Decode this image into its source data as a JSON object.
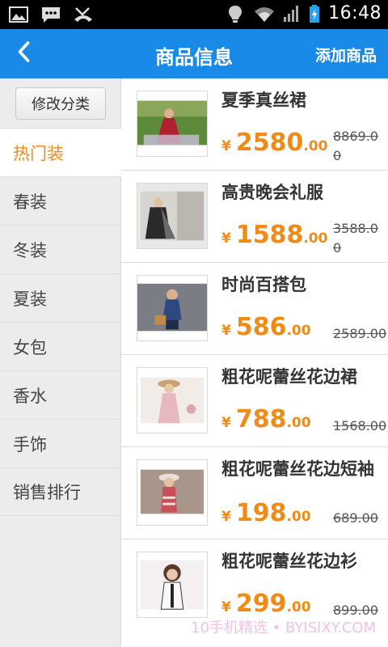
{
  "status_bar": {
    "time": "16:48"
  },
  "header": {
    "title": "商品信息",
    "add_label": "添加商品"
  },
  "sidebar": {
    "edit_label": "修改分类",
    "categories": [
      {
        "label": "热门装",
        "active": true
      },
      {
        "label": "春装"
      },
      {
        "label": "冬装"
      },
      {
        "label": "夏装"
      },
      {
        "label": "女包"
      },
      {
        "label": "香水"
      },
      {
        "label": "手饰"
      },
      {
        "label": "销售排行"
      }
    ]
  },
  "currency_symbol": "¥",
  "products": [
    {
      "name": "夏季真丝裙",
      "price_int": "2580",
      "price_dec": ".00",
      "old_price": "8869.00"
    },
    {
      "name": "高贵晚会礼服",
      "price_int": "1588",
      "price_dec": ".00",
      "old_price": "3588.00"
    },
    {
      "name": "时尚百搭包",
      "price_int": "586",
      "price_dec": ".00",
      "old_price": "2589.00"
    },
    {
      "name": "粗花呢蕾丝花边裙",
      "price_int": "788",
      "price_dec": ".00",
      "old_price": "1568.00"
    },
    {
      "name": "粗花呢蕾丝花边短袖",
      "price_int": "198",
      "price_dec": ".00",
      "old_price": "689.00"
    },
    {
      "name": "粗花呢蕾丝花边衫",
      "price_int": "299",
      "price_dec": ".00",
      "old_price": "899.00"
    }
  ],
  "watermark": "10手机精选 • BYISIXY.COM",
  "colors": {
    "primary": "#1a8ae8",
    "accent": "#ef8b16",
    "sidebar_bg": "#ececec"
  }
}
